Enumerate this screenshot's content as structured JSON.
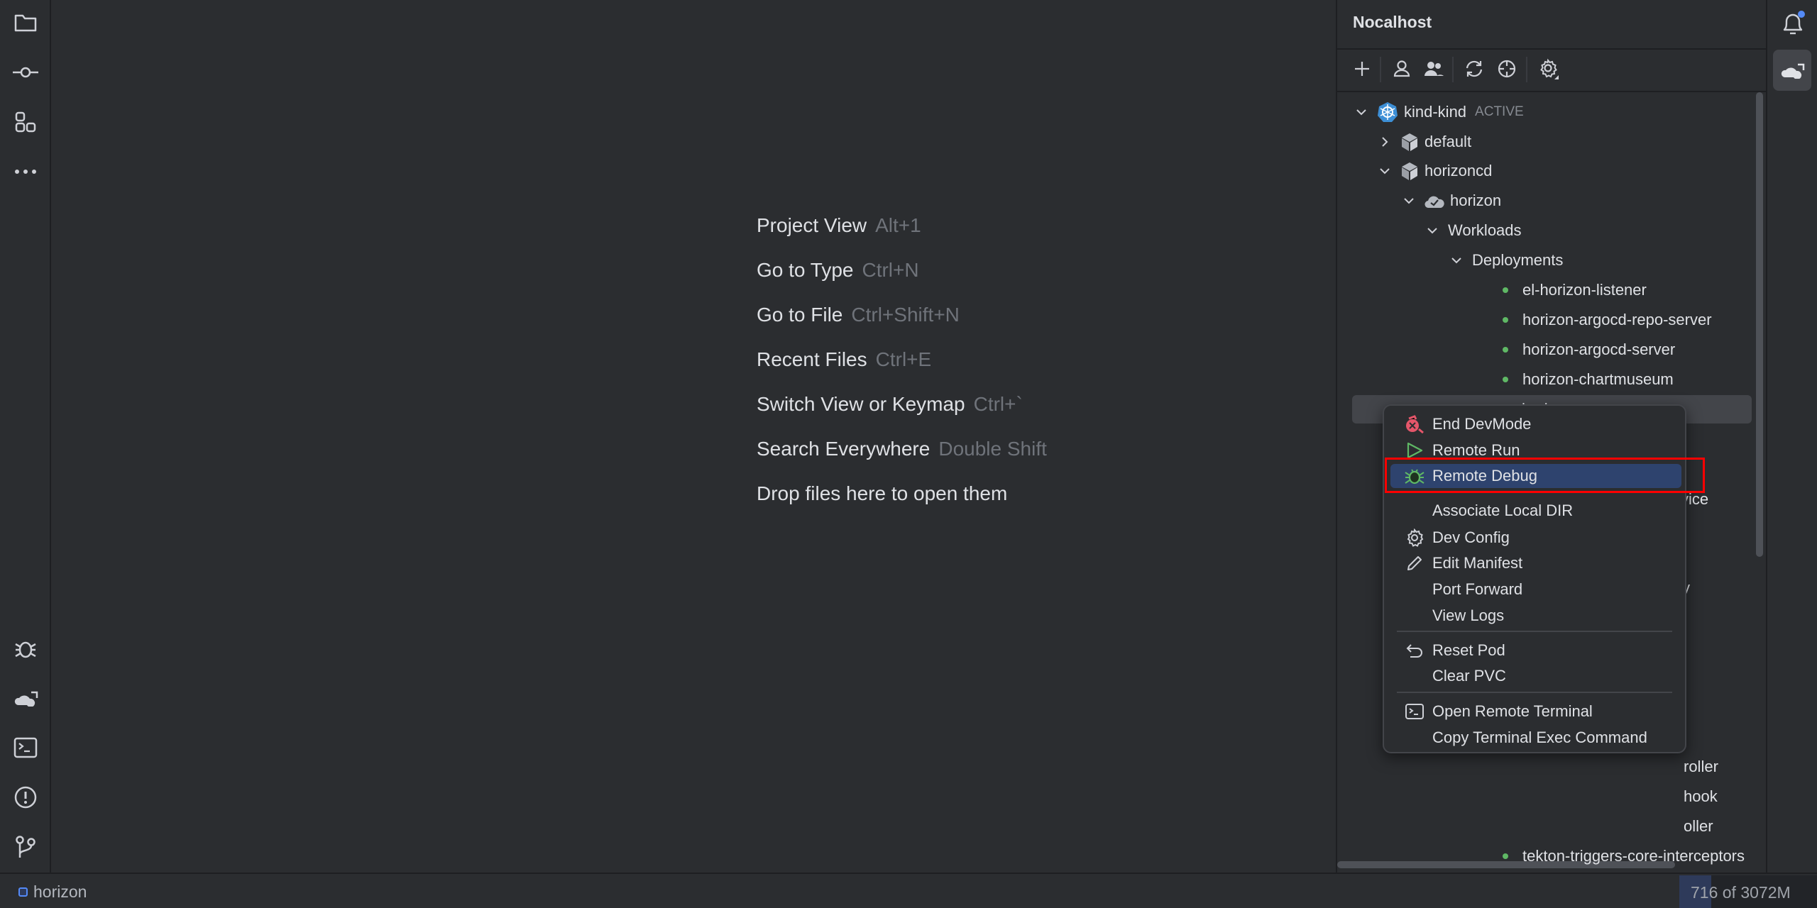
{
  "left_toolbar": {
    "top": [
      "folder-icon",
      "commit-icon",
      "structure-icon",
      "more-icon"
    ],
    "bottom": [
      "debug-icon",
      "nocalhost-icon",
      "terminal-icon",
      "problems-icon",
      "git-branch-icon"
    ]
  },
  "editor": {
    "hints": [
      {
        "label": "Project View",
        "shortcut": "Alt+1"
      },
      {
        "label": "Go to Type",
        "shortcut": "Ctrl+N"
      },
      {
        "label": "Go to File",
        "shortcut": "Ctrl+Shift+N"
      },
      {
        "label": "Recent Files",
        "shortcut": "Ctrl+E"
      },
      {
        "label": "Switch View or Keymap",
        "shortcut": "Ctrl+`"
      },
      {
        "label": "Search Everywhere",
        "shortcut": "Double Shift"
      },
      {
        "label": "Drop files here to open them",
        "shortcut": ""
      }
    ]
  },
  "panel": {
    "title": "Nocalhost",
    "toolbar": [
      "plus-icon",
      "user-icon",
      "users-icon",
      "refresh-icon",
      "locate-icon",
      "settings-icon"
    ],
    "tree": {
      "cluster": {
        "label": "kind-kind",
        "status": "ACTIVE"
      },
      "namespaces": [
        "default",
        "horizoncd"
      ],
      "app": "horizon",
      "workloads": "Workloads",
      "deployments": "Deployments",
      "items": [
        "el-horizon-listener",
        "horizon-argocd-repo-server",
        "horizon-argocd-server",
        "horizon-chartmuseum",
        "horizon"
      ],
      "partial_items": [
        "vice",
        "y",
        "roller",
        "hook",
        "oller"
      ],
      "last_item": "tekton-triggers-core-interceptors"
    }
  },
  "context_menu": {
    "items": [
      {
        "label": "End DevMode",
        "icon": "end-devmode-icon"
      },
      {
        "label": "Remote Run",
        "icon": "run-icon"
      },
      {
        "label": "Remote Debug",
        "icon": "debug-icon",
        "highlighted": true
      },
      {
        "label": "Associate Local DIR",
        "icon": ""
      },
      {
        "label": "Dev Config",
        "icon": "gear-icon"
      },
      {
        "label": "Edit Manifest",
        "icon": "pencil-icon"
      },
      {
        "label": "Port Forward",
        "icon": ""
      },
      {
        "label": "View Logs",
        "icon": ""
      },
      {
        "label": "Reset Pod",
        "icon": "undo-icon"
      },
      {
        "label": "Clear PVC",
        "icon": ""
      },
      {
        "label": "Open Remote Terminal",
        "icon": "terminal-icon"
      },
      {
        "label": "Copy Terminal Exec Command",
        "icon": ""
      }
    ]
  },
  "status_bar": {
    "project": "horizon",
    "memory": "716 of 3072M",
    "memory_fraction": 0.233
  },
  "colors": {
    "accent": "#548af7",
    "highlight": "#2e436e",
    "running": "#5fb865",
    "annotation": "#ff0000"
  }
}
